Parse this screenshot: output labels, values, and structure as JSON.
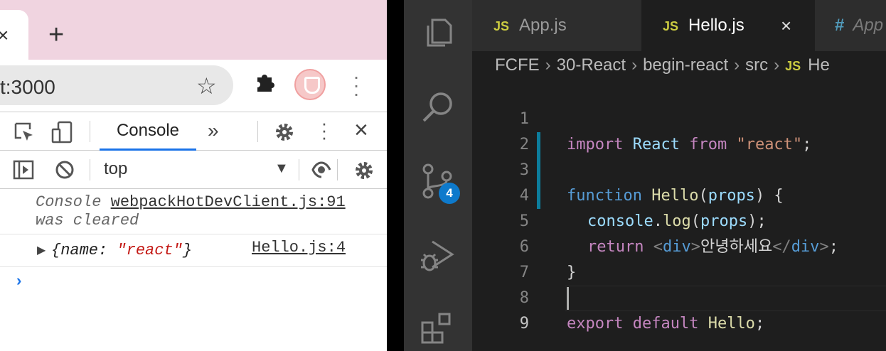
{
  "browser": {
    "tab_close": "×",
    "new_tab": "+",
    "address": "t:3000",
    "star_icon": "☆",
    "kebab": "⋮"
  },
  "devtools": {
    "tab_console": "Console",
    "more_tabs": "»",
    "context": "top",
    "context_caret": "▼",
    "messages": {
      "cleared_word": "Console",
      "cleared_link": "webpackHotDevClient.js:91",
      "cleared_rest": "was cleared",
      "log_arrow": "▶",
      "log_open": "{name: ",
      "log_value": "\"react\"",
      "log_close": "}",
      "log_source": "Hello.js:4"
    },
    "prompt": "›"
  },
  "vscode": {
    "badge_count": "4",
    "tabs": [
      {
        "icon": "JS",
        "label": "App.js"
      },
      {
        "icon": "JS",
        "label": "Hello.js",
        "close": "×"
      },
      {
        "icon": "#",
        "label": "App"
      }
    ],
    "breadcrumb": {
      "parts": [
        "FCFE",
        "30-React",
        "begin-react",
        "src"
      ],
      "sep": "›",
      "file_icon": "JS",
      "file": "He"
    },
    "code": {
      "line_numbers": [
        "1",
        "2",
        "3",
        "4",
        "5",
        "6",
        "7",
        "8",
        "9"
      ],
      "l1": {
        "import": "import",
        "react": "React",
        "from": "from",
        "str": "\"react\"",
        "semi": ";"
      },
      "l3": {
        "function": "function",
        "name": "Hello",
        "open": "(",
        "param": "props",
        "close": ") {"
      },
      "l4": {
        "obj": "console",
        "dot": ".",
        "method": "log",
        "open": "(",
        "arg": "props",
        "close": ");"
      },
      "l5": {
        "return": "return",
        "lt": "<",
        "tag": "div",
        "gt": ">",
        "text": "안녕하세요",
        "lt2": "</",
        "tag2": "div",
        "gt2": ">",
        "semi": ";"
      },
      "l6": "}",
      "l8": {
        "export": "export",
        "default": "default",
        "name": "Hello",
        "semi": ";"
      }
    }
  },
  "colors": {
    "chrome_tabstrip": "#f0d4e0",
    "devtools_accent": "#1a73e8",
    "vscode_editor": "#1e1e1e",
    "vscode_activity": "#333333",
    "badge": "#0e7acc"
  }
}
